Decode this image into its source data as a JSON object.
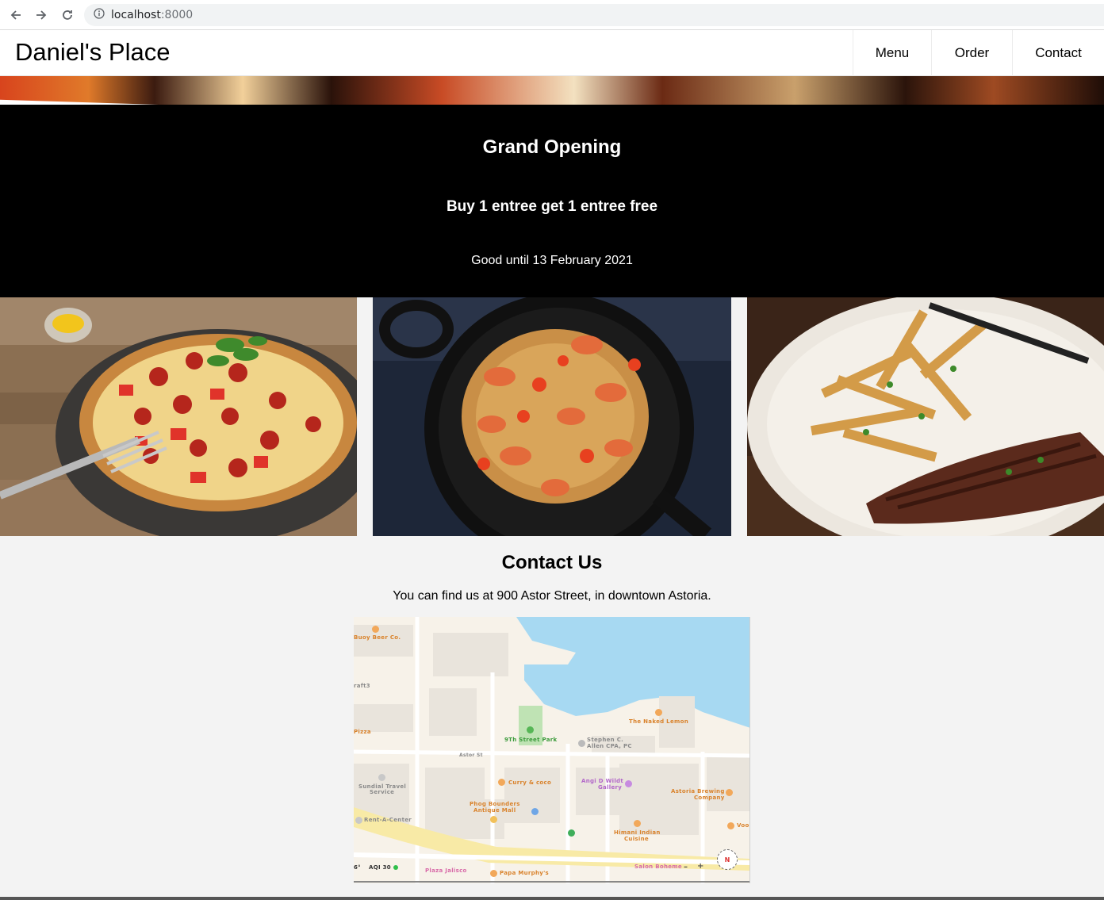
{
  "browser": {
    "url_host": "localhost",
    "url_port": ":8000"
  },
  "site": {
    "brand": "Daniel's Place",
    "nav": [
      {
        "label": "Menu"
      },
      {
        "label": "Order"
      },
      {
        "label": "Contact"
      }
    ]
  },
  "promo": {
    "title": "Grand Opening",
    "offer": "Buy 1 entree get 1 entree free",
    "validity": "Good until 13 February 2021"
  },
  "gallery": {
    "items": [
      {
        "subject": "pizza"
      },
      {
        "subject": "shrimp-spaghetti"
      },
      {
        "subject": "steak-and-fries"
      }
    ]
  },
  "contact": {
    "heading": "Contact Us",
    "address_text": "You can find us at 900 Astor Street, in downtown Astoria."
  },
  "map": {
    "labels": {
      "buoy": "Buoy Beer Co.",
      "craft": "raft3",
      "pizza": "Pizza",
      "naked_lemon": "The Naked Lemon",
      "park": "9Th Street Park",
      "stephen": "Stephen C.",
      "stephen2": "Allen CPA, PC",
      "astor_st": "Astor St",
      "sundial1": "Sundial Travel",
      "sundial2": "Service",
      "curry": "Curry & coco",
      "angi1": "Angi D Wildt",
      "angi2": "Gallery",
      "astoria1": "Astoria Brewing",
      "astoria2": "Company",
      "phog1": "Phog Bounders",
      "phog2": "Antique Mall",
      "rent": "Rent-A-Center",
      "himani1": "Himani Indian",
      "himani2": "Cuisine",
      "voo": "Voo",
      "temp": "6°",
      "aqi": "AQI 30",
      "jalisco": "Plaza Jalisco",
      "papa": "Papa Murphy's",
      "salon": "Salon Boheme",
      "compass": "N"
    },
    "colors": {
      "water": "#a7d9f2",
      "land": "#f7f2e9",
      "road_major": "#f8eaa6",
      "park": "#bfe3b4",
      "block": "#e9e4dc"
    }
  }
}
